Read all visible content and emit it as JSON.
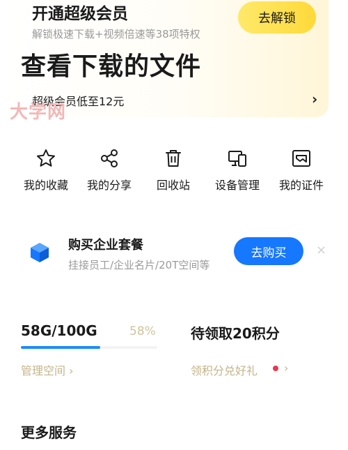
{
  "vip": {
    "title": "开通超级会员",
    "subtitle": "解锁极速下载+视频倍速等38项特权",
    "unlock_button": "去解锁",
    "promo_text": "超级会员低至12元",
    "promo_chevron": "›"
  },
  "page_title": "查看下载的文件",
  "watermark": "大学网",
  "tools": [
    {
      "label": "我的收藏",
      "icon": "star-icon"
    },
    {
      "label": "我的分享",
      "icon": "share-icon"
    },
    {
      "label": "回收站",
      "icon": "trash-icon"
    },
    {
      "label": "设备管理",
      "icon": "devices-icon"
    },
    {
      "label": "我的证件",
      "icon": "id-card-icon"
    }
  ],
  "enterprise": {
    "title": "购买企业套餐",
    "subtitle": "挂接员工/企业名片/20T空间等",
    "buy_button": "去购买",
    "close": "×",
    "icon": "cube-icon"
  },
  "storage": {
    "used_text": "58G/100G",
    "percent_text": "58%",
    "percent": 0.58,
    "manage_link": "管理空间 ›"
  },
  "points": {
    "title": "待领取20积分",
    "link": "领积分兑好礼",
    "chevron": "›"
  },
  "more_services": "更多服务",
  "colors": {
    "accent_blue": "#1677ff",
    "vip_yellow": "#ffd93a",
    "link_gold": "#c4b48a",
    "badge_red": "#e8384f"
  }
}
